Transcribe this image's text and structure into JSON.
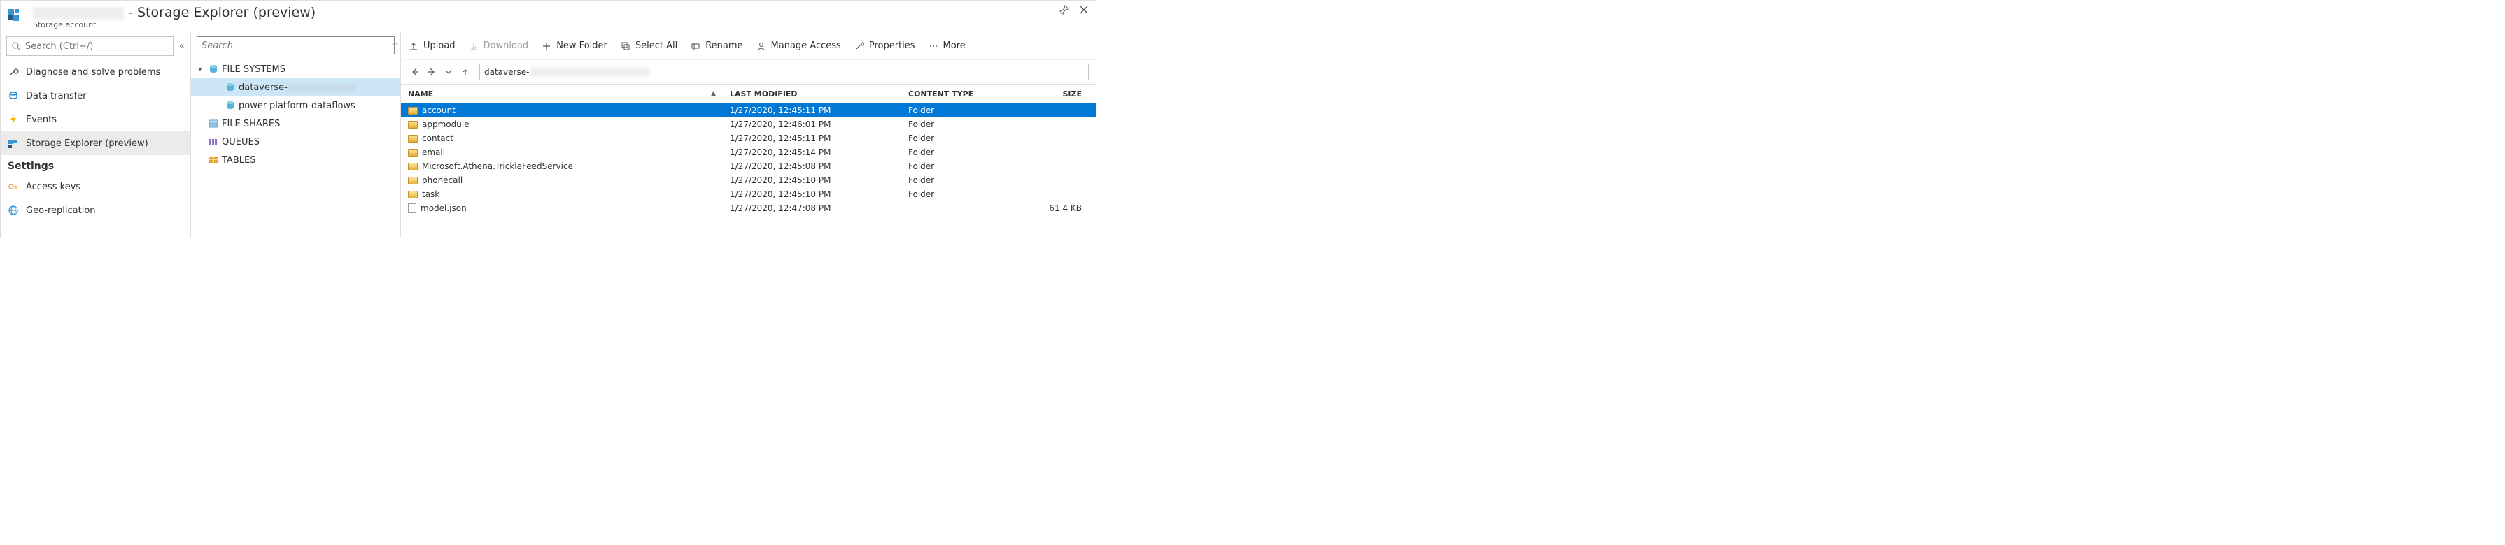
{
  "titlebar": {
    "title_suffix": "- Storage Explorer (preview)",
    "subtitle": "Storage account"
  },
  "left": {
    "search_placeholder": "Search (Ctrl+/)",
    "items": [
      {
        "icon": "wrench",
        "label": "Diagnose and solve problems"
      },
      {
        "icon": "transfer",
        "label": "Data transfer"
      },
      {
        "icon": "bolt",
        "label": "Events"
      },
      {
        "icon": "explorer",
        "label": "Storage Explorer (preview)",
        "selected": true
      }
    ],
    "settings_header": "Settings",
    "settings_items": [
      {
        "icon": "key",
        "label": "Access keys"
      },
      {
        "icon": "globe",
        "label": "Geo-replication"
      }
    ]
  },
  "mid": {
    "search_placeholder": "Search",
    "tree": [
      {
        "depth": 0,
        "twisty": "open",
        "icon": "container",
        "label": "FILE SYSTEMS"
      },
      {
        "depth": 1,
        "twisty": "none",
        "icon": "container",
        "label": "dataverse-",
        "redacted": true,
        "selected": true
      },
      {
        "depth": 1,
        "twisty": "none",
        "icon": "container",
        "label": "power-platform-dataflows"
      },
      {
        "depth": 0,
        "twisty": "none",
        "icon": "fileshare",
        "label": "FILE SHARES"
      },
      {
        "depth": 0,
        "twisty": "none",
        "icon": "queue",
        "label": "QUEUES"
      },
      {
        "depth": 0,
        "twisty": "none",
        "icon": "table",
        "label": "TABLES"
      }
    ]
  },
  "toolbar": {
    "upload": "Upload",
    "download": "Download",
    "new_folder": "New Folder",
    "select_all": "Select All",
    "rename": "Rename",
    "manage_access": "Manage Access",
    "properties": "Properties",
    "more": "More"
  },
  "navbar": {
    "path_prefix": "dataverse-"
  },
  "grid": {
    "header": {
      "name": "NAME",
      "modified": "LAST MODIFIED",
      "type": "CONTENT TYPE",
      "size": "SIZE"
    },
    "rows": [
      {
        "icon": "folder",
        "name": "account",
        "modified": "1/27/2020, 12:45:11 PM",
        "type": "Folder",
        "size": "",
        "selected": true
      },
      {
        "icon": "folder",
        "name": "appmodule",
        "modified": "1/27/2020, 12:46:01 PM",
        "type": "Folder",
        "size": ""
      },
      {
        "icon": "folder",
        "name": "contact",
        "modified": "1/27/2020, 12:45:11 PM",
        "type": "Folder",
        "size": ""
      },
      {
        "icon": "folder",
        "name": "email",
        "modified": "1/27/2020, 12:45:14 PM",
        "type": "Folder",
        "size": ""
      },
      {
        "icon": "folder",
        "name": "Microsoft.Athena.TrickleFeedService",
        "modified": "1/27/2020, 12:45:08 PM",
        "type": "Folder",
        "size": ""
      },
      {
        "icon": "folder",
        "name": "phonecall",
        "modified": "1/27/2020, 12:45:10 PM",
        "type": "Folder",
        "size": ""
      },
      {
        "icon": "folder",
        "name": "task",
        "modified": "1/27/2020, 12:45:10 PM",
        "type": "Folder",
        "size": ""
      },
      {
        "icon": "file",
        "name": "model.json",
        "modified": "1/27/2020, 12:47:08 PM",
        "type": "",
        "size": "61.4 KB"
      }
    ]
  }
}
